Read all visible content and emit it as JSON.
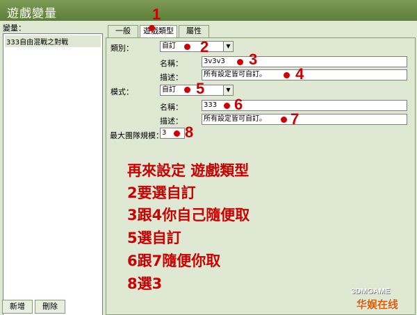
{
  "window": {
    "title": "遊戲變量"
  },
  "sidebar": {
    "label": "變量：",
    "items": [
      {
        "label": "333自由混戰之對戰"
      }
    ],
    "buttons": {
      "new_label": "新增",
      "delete_label": "刪除"
    }
  },
  "tabs": [
    {
      "label": "一般"
    },
    {
      "label": "遊戲類型"
    },
    {
      "label": "屬性"
    }
  ],
  "form": {
    "category_label": "類別：",
    "category_value": "自訂",
    "category_name_label": "名稱：",
    "category_name_value": "3v3v3",
    "category_desc_label": "描述：",
    "category_desc_value": "所有設定皆可自訂。",
    "mode_label": "模式：",
    "mode_value": "自訂",
    "mode_name_label": "名稱：",
    "mode_name_value": "333",
    "mode_desc_label": "描述：",
    "mode_desc_value": "所有設定皆可自訂。",
    "team_size_label": "最大團隊規模：",
    "team_size_value": "3"
  },
  "annotations": {
    "numbers": [
      "1",
      "2",
      "3",
      "4",
      "5",
      "6",
      "7",
      "8"
    ],
    "notes": [
      "再來設定 遊戲類型",
      "2要選自訂",
      "3跟4你自己隨便取",
      "5選自訂",
      "6跟7隨便你取",
      "8選3"
    ],
    "dot_color": "#d00000",
    "text_color": "#cc0000"
  },
  "watermark": {
    "line1": "3DMGAME",
    "line2": "华娱在线"
  },
  "colors": {
    "titlebar": "#5e7f3a",
    "window_bg": "#dfe8d3"
  }
}
